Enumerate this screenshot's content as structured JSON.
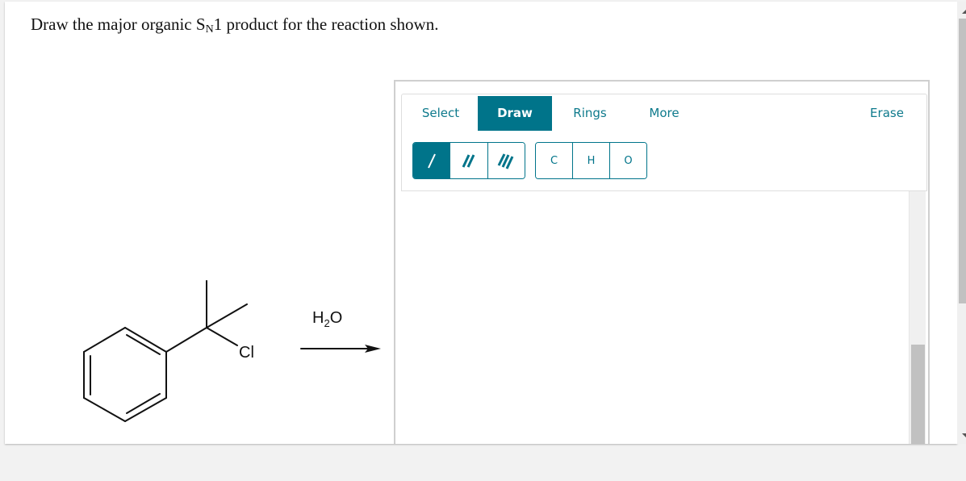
{
  "question": {
    "prefix": "Draw the major organic S",
    "subscript": "N",
    "suffix": "1 product for the reaction shown."
  },
  "reaction": {
    "reactant_label": "Cl",
    "reagent": {
      "main": "H",
      "sub": "2",
      "tail": "O"
    }
  },
  "sketcher": {
    "tabs": [
      {
        "label": "Select",
        "active": false
      },
      {
        "label": "Draw",
        "active": true
      },
      {
        "label": "Rings",
        "active": false
      },
      {
        "label": "More",
        "active": false
      }
    ],
    "erase_label": "Erase",
    "bond_tools": [
      {
        "name": "single-bond",
        "active": true
      },
      {
        "name": "double-bond",
        "active": false
      },
      {
        "name": "triple-bond",
        "active": false
      }
    ],
    "atom_tools": [
      {
        "label": "C"
      },
      {
        "label": "H"
      },
      {
        "label": "O"
      }
    ]
  },
  "colors": {
    "accent": "#00748a",
    "accent_text": "#0e7a8c"
  }
}
